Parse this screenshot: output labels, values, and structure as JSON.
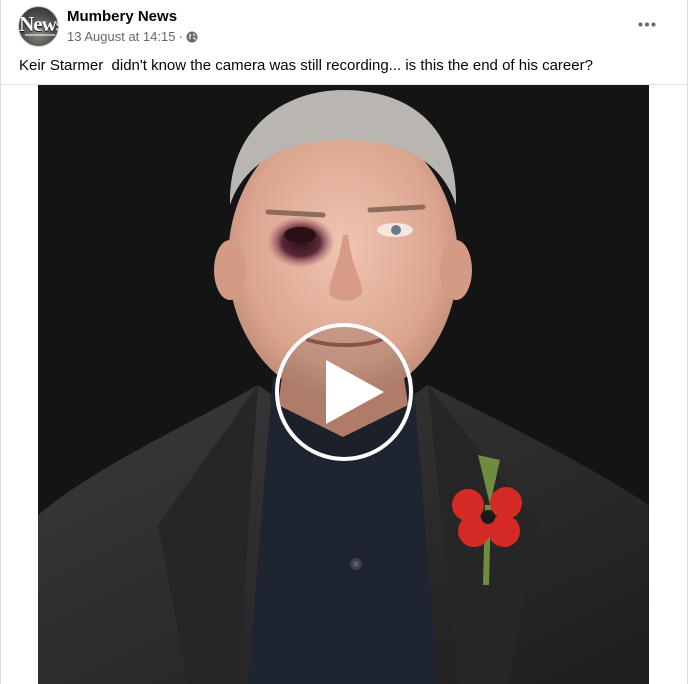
{
  "post": {
    "page_name": "Mumbery News",
    "avatar_text": "News",
    "timestamp": "13 August at 14:15",
    "separator": "·",
    "privacy_icon": "globe-icon",
    "more_icon": "more-options-icon",
    "caption": "Keir Starmer  didn't know the camera was still recording... is this the end of his career?"
  },
  "video": {
    "play_icon": "play-icon",
    "colors": {
      "background": "#141414",
      "jacket": "#2c2c2c",
      "shirt": "#1f2530",
      "skin": "#e6b6a2",
      "hair": "#b9b6b1",
      "bruise": "#5a2636",
      "poppy": "#d62a24",
      "stem": "#6e8c3f"
    }
  }
}
